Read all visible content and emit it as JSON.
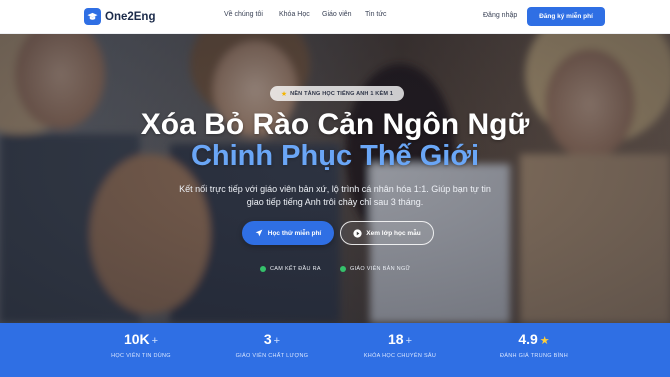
{
  "brand": {
    "name": "One2Eng",
    "accent": "#2f6fe4"
  },
  "nav": {
    "links": [
      "Về chúng tôi",
      "Khóa Học",
      "Giáo viên",
      "Tin tức"
    ],
    "login": "Đăng nhập",
    "signup": "Đăng ký miễn phí"
  },
  "hero": {
    "badge": "NỀN TẢNG HỌC TIẾNG ANH 1 KÈM 1",
    "title_line1": "Xóa Bỏ Rào Cản Ngôn Ngữ",
    "title_line2": "Chinh Phục Thế Giới",
    "subtitle": "Kết nối trực tiếp với giáo viên bản xứ, lộ trình cá nhân hóa 1:1. Giúp bạn tự tin giao tiếp tiếng Anh trôi chảy chỉ sau 3 tháng.",
    "cta_primary": "Học thử miễn phí",
    "cta_secondary": "Xem lớp học mẫu",
    "checks": [
      "CAM KẾT ĐẦU RA",
      "GIÁO VIÊN BẢN NGỮ"
    ],
    "title_highlight_color": "#6aa6f6"
  },
  "stats": [
    {
      "value": "10K",
      "suffix": "+",
      "label": "HỌC VIÊN TIN DÙNG"
    },
    {
      "value": "3",
      "suffix": "+",
      "label": "GIÁO VIÊN CHẤT LƯỢNG"
    },
    {
      "value": "18",
      "suffix": "+",
      "label": "KHÓA HỌC CHUYÊN SÂU"
    },
    {
      "value": "4.9",
      "suffix": "★",
      "label": "ĐÁNH GIÁ TRUNG BÌNH"
    }
  ]
}
